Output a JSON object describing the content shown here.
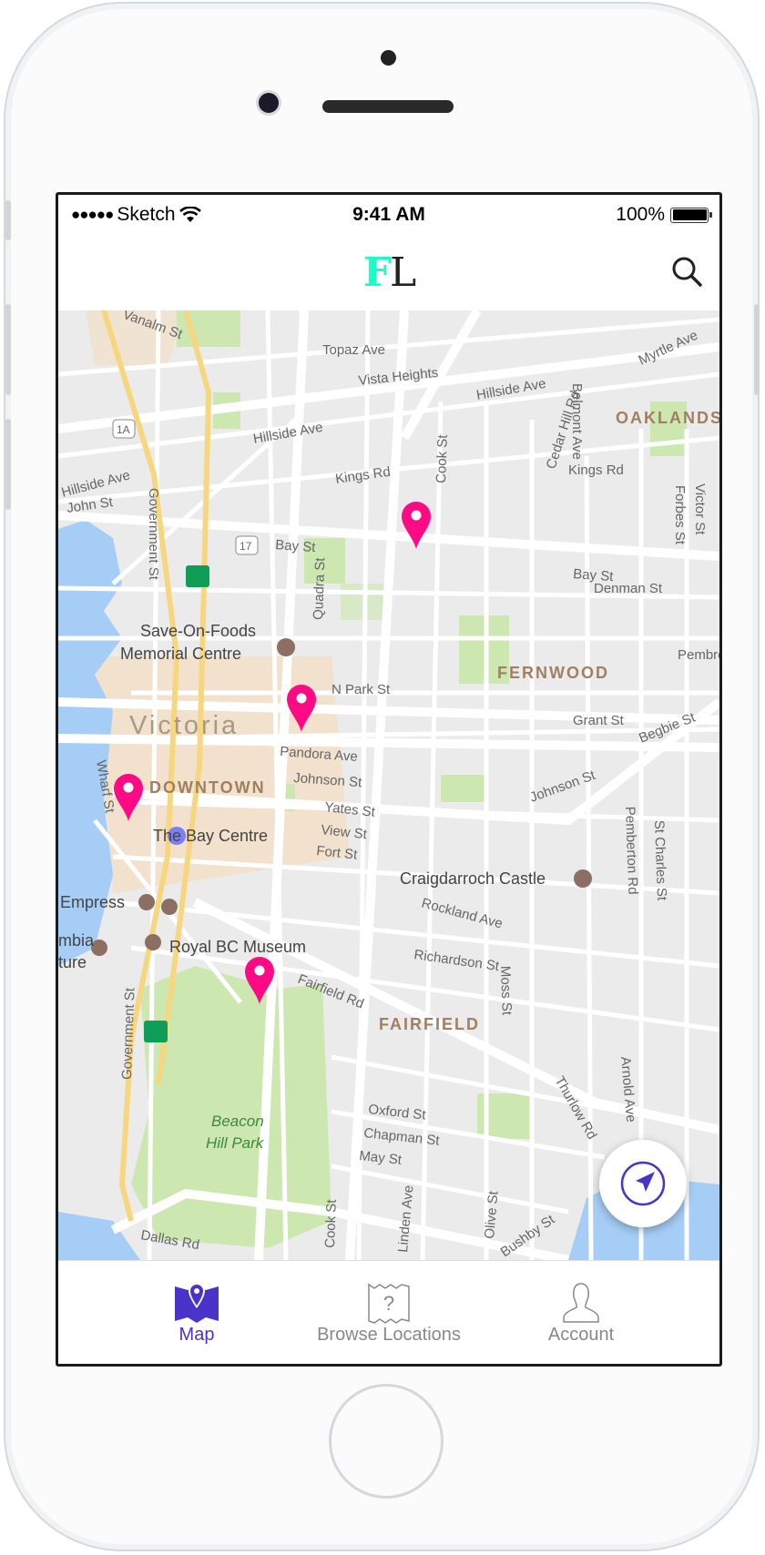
{
  "status_bar": {
    "carrier": "Sketch",
    "time": "9:41 AM",
    "battery": "100%",
    "signal_bars": 5,
    "battery_level": 1.0
  },
  "header": {
    "logo_first": "F",
    "logo_second": "L",
    "logo_colors": {
      "first": "#1affc5",
      "second": "#222222"
    },
    "search_icon": "search-icon"
  },
  "map": {
    "labels": [
      "Topaz Ave",
      "Vista Heights",
      "Hillside Ave",
      "Myrtle Ave",
      "OAKLANDS",
      "Hillside Ave",
      "1A",
      "Hillside Ave",
      "John St",
      "Kings Rd",
      "Cook St",
      "Cedar Hill Rd",
      "Kings Rd",
      "Belmont Ave",
      "Forbes St",
      "Victor St",
      "Government St",
      "Bay St",
      "17",
      "Quadra St",
      "Bay St",
      "Denman St",
      "Save-On-Foods",
      "Memorial Centre",
      "Pembro",
      "FERNWOOD",
      "N Park St",
      "Victoria",
      "Grant St",
      "Begbie St",
      "Pandora Ave",
      "Wharf St",
      "DOWNTOWN",
      "Johnson St",
      "Johnson St",
      "The Bay Centre",
      "Yates St",
      "View St",
      "Fort St",
      "St Charles St",
      "Pemberton Rd",
      "Craigdarroch Castle",
      "Empress",
      "Rockland Ave",
      "mbia",
      "ture",
      "Royal BC Museum",
      "Richardson St",
      "Fairfield Rd",
      "FAIRFIELD",
      "Moss St",
      "Government St",
      "Arnold Ave",
      "Thurlow Rd",
      "Oxford St",
      "Chapman St",
      "May St",
      "Beacon",
      "Hill Park",
      "Cook St",
      "Linden Ave",
      "Olive St",
      "Bushby St",
      "Dallas Rd",
      "Vanalm St"
    ],
    "pin_color": "#ff0a85",
    "pin_count": 4
  },
  "locate_button": {
    "icon": "navigation-arrow-icon",
    "color": "#4a33c9"
  },
  "tabbar": {
    "active_color": "#4a33c9",
    "tabs": [
      {
        "label": "Map",
        "icon": "map-pin-icon",
        "active": true
      },
      {
        "label": "Browse Locations",
        "icon": "map-question-icon",
        "active": false
      },
      {
        "label": "Account",
        "icon": "person-icon",
        "active": false
      }
    ]
  }
}
